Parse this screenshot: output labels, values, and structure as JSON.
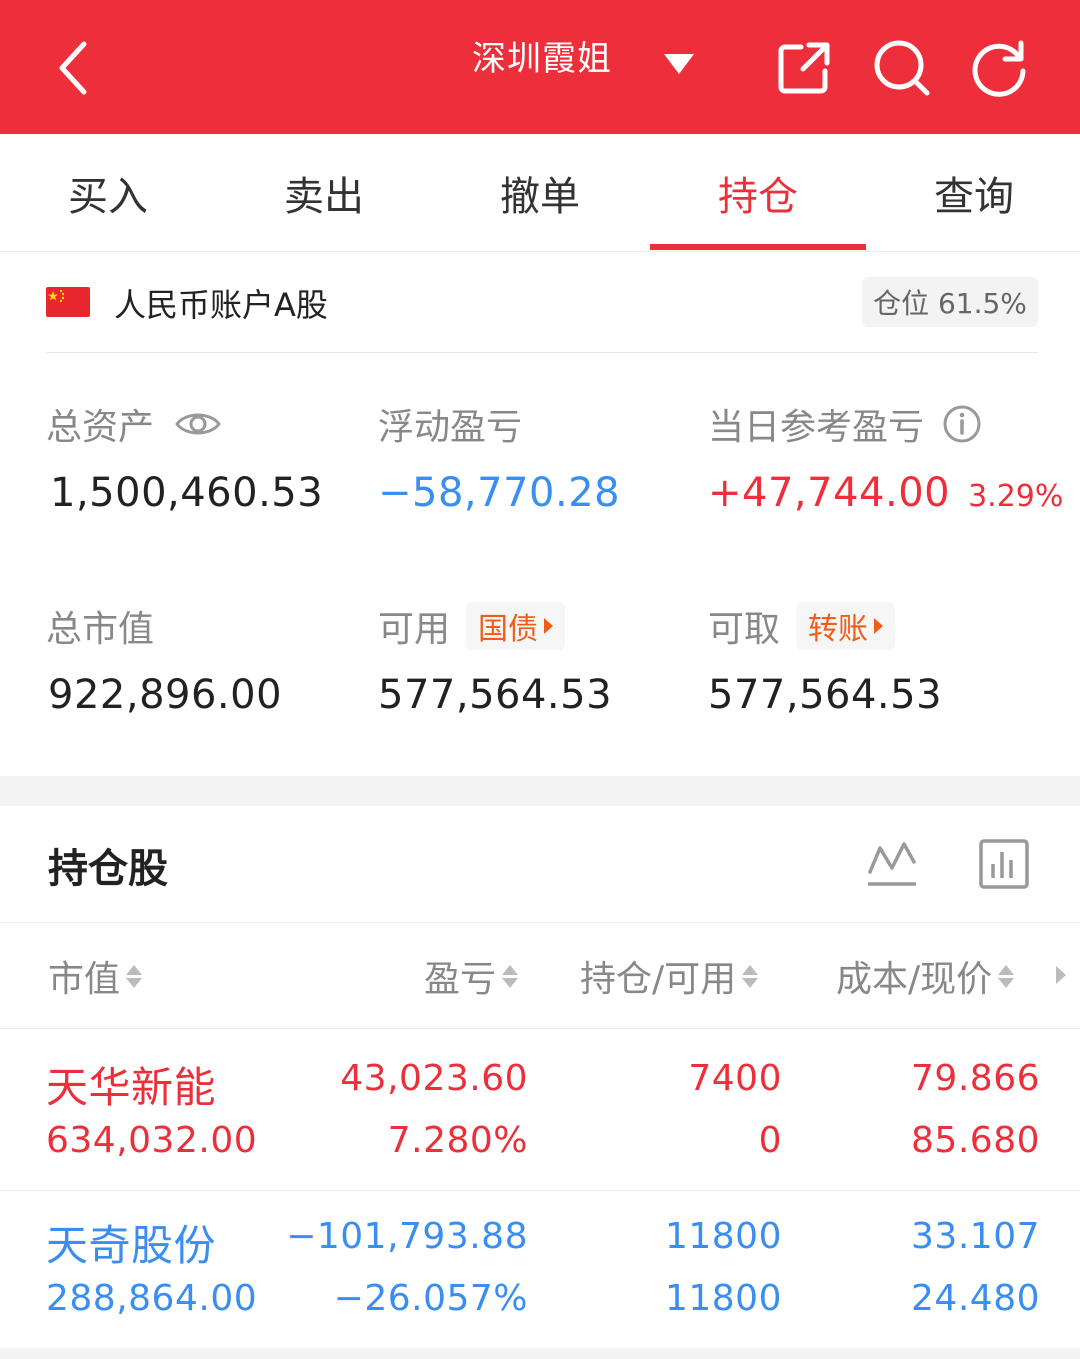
{
  "header": {
    "title": "深圳霞姐",
    "bg_color": "#ec2f3a"
  },
  "tabs": [
    {
      "label": "买入"
    },
    {
      "label": "卖出"
    },
    {
      "label": "撤单"
    },
    {
      "label": "持仓",
      "active": true
    },
    {
      "label": "查询"
    }
  ],
  "account": {
    "name": "人民币账户A股",
    "position_label": "仓位 61.5%"
  },
  "stats": {
    "total_assets_label": "总资产",
    "total_assets": "1,500,460.53",
    "floating_pnl_label": "浮动盈亏",
    "floating_pnl": "−58,770.28",
    "daily_pnl_label": "当日参考盈亏",
    "daily_pnl": "+47,744.00",
    "daily_pnl_pct": "3.29%",
    "market_value_label": "总市值",
    "market_value": "922,896.00",
    "available_label": "可用",
    "available_chip": "国债",
    "available": "577,564.53",
    "withdrawable_label": "可取",
    "withdrawable_chip": "转账",
    "withdrawable": "577,564.53"
  },
  "holdings": {
    "title": "持仓股",
    "columns": [
      "市值",
      "盈亏",
      "持仓/可用",
      "成本/现价"
    ],
    "rows": [
      {
        "name": "天华新能",
        "market_value": "634,032.00",
        "pnl": "43,023.60",
        "pnl_pct": "7.280%",
        "position": "7400",
        "available": "0",
        "cost": "79.866",
        "price": "85.680",
        "color": "#ec2f3a"
      },
      {
        "name": "天奇股份",
        "market_value": "288,864.00",
        "pnl": "−101,793.88",
        "pnl_pct": "−26.057%",
        "position": "11800",
        "available": "11800",
        "cost": "33.107",
        "price": "24.480",
        "color": "#3a8ef0"
      }
    ]
  },
  "colors": {
    "accent": "#ec2f3a",
    "loss": "#3a8ef0",
    "chip": "#f25c19"
  },
  "icons": [
    "back-icon",
    "dropdown-caret-icon",
    "share-icon",
    "search-icon",
    "refresh-icon",
    "eye-icon",
    "info-icon",
    "line-chart-icon",
    "bar-chart-icon",
    "china-flag-icon"
  ]
}
